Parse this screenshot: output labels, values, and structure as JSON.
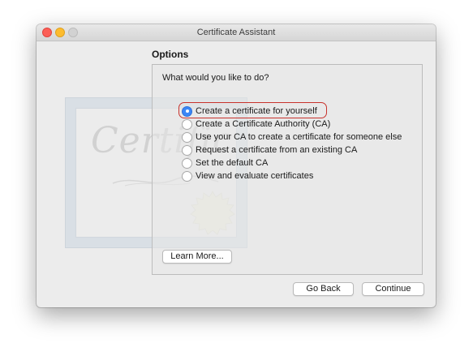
{
  "window": {
    "title": "Certificate Assistant"
  },
  "watermark": {
    "word": "Certific"
  },
  "section": {
    "title": "Options"
  },
  "panel": {
    "question": "What would you like to do?",
    "options": [
      {
        "label": "Create a certificate for yourself",
        "selected": true
      },
      {
        "label": "Create a Certificate Authority (CA)",
        "selected": false
      },
      {
        "label": "Use your CA to create a certificate for someone else",
        "selected": false
      },
      {
        "label": "Request a certificate from an existing CA",
        "selected": false
      },
      {
        "label": "Set the default CA",
        "selected": false
      },
      {
        "label": "View and evaluate certificates",
        "selected": false
      }
    ],
    "learn_more_label": "Learn More..."
  },
  "footer": {
    "back_label": "Go Back",
    "continue_label": "Continue"
  },
  "colors": {
    "accent": "#3b87f6",
    "highlight": "#c8322c"
  }
}
